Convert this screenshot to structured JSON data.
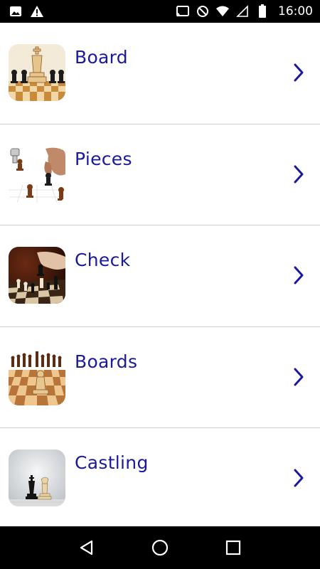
{
  "status_bar": {
    "time": "16:00",
    "left_icons": [
      "image-icon",
      "warning-icon"
    ],
    "right_icons": [
      "cast-icon",
      "do-not-disturb-icon",
      "wifi-icon",
      "signal-icon",
      "battery-icon"
    ]
  },
  "topics": [
    {
      "label": "Board",
      "thumbnail": "chess-board-king-thumbnail"
    },
    {
      "label": "Pieces",
      "thumbnail": "chess-pieces-hand-thumbnail"
    },
    {
      "label": "Check",
      "thumbnail": "chess-check-hand-thumbnail"
    },
    {
      "label": "Boards",
      "thumbnail": "chess-boards-thumbnail"
    },
    {
      "label": "Castling",
      "thumbnail": "chess-castling-thumbnail"
    }
  ],
  "colors": {
    "label": "#1a1a9c",
    "chevron": "#1a1a9c",
    "divider": "#cfcfcf",
    "bars": "#000000"
  },
  "nav_bar": {
    "buttons": [
      "back-icon",
      "home-icon",
      "recents-icon"
    ]
  }
}
